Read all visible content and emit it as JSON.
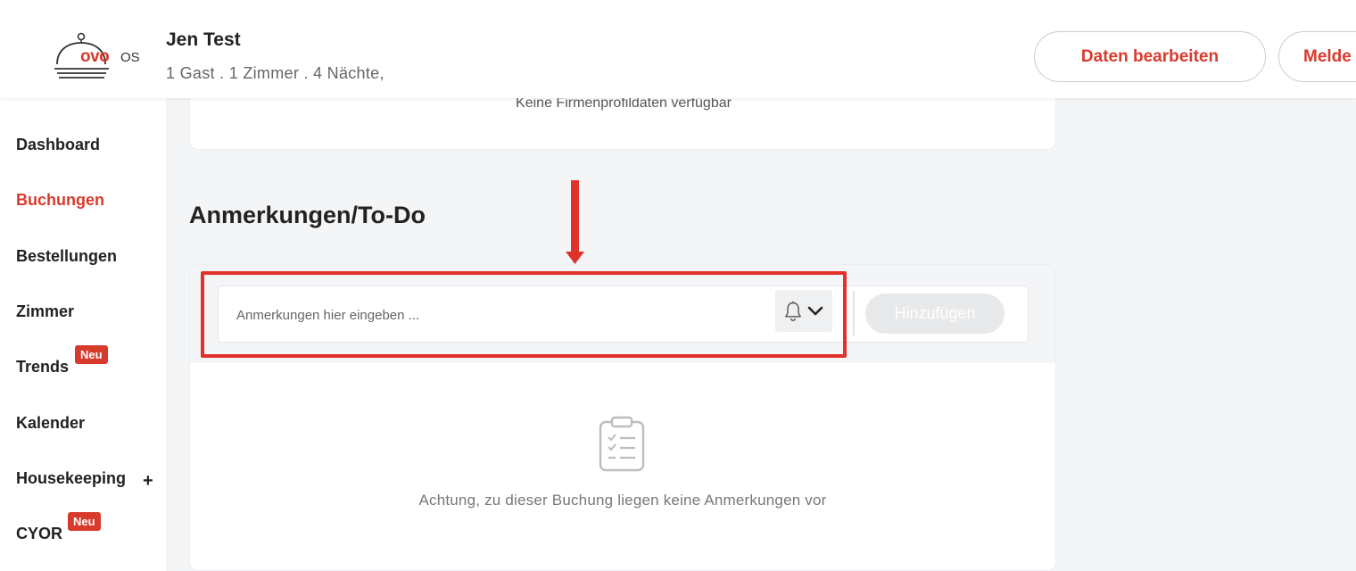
{
  "header": {
    "logo_wordmark": "ovo",
    "logo_suffix": "OS",
    "guest_name": "Jen Test",
    "guest_info": "1 Gast . 1 Zimmer . 4 Nächte,",
    "edit_button": "Daten bearbeiten",
    "report_button": "Melde"
  },
  "sidebar": {
    "items": [
      {
        "label": "Dashboard"
      },
      {
        "label": "Buchungen"
      },
      {
        "label": "Bestellungen"
      },
      {
        "label": "Zimmer"
      },
      {
        "label": "Trends",
        "badge": "Neu"
      },
      {
        "label": "Kalender"
      },
      {
        "label": "Housekeeping",
        "expand": "+"
      },
      {
        "label": "CYOR",
        "badge": "Neu"
      }
    ],
    "active": "Buchungen"
  },
  "company_profile": {
    "empty_text": "Keine Firmenprofildaten verfügbar"
  },
  "notes": {
    "title": "Anmerkungen/To-Do",
    "input_placeholder": "Anmerkungen hier eingeben ...",
    "input_value": "",
    "add_button": "Hinzufügen",
    "empty_text": "Achtung, zu dieser Buchung liegen keine Anmerkungen vor"
  },
  "icons": {
    "logo": "cloche-icon",
    "reminder": "bell-icon",
    "dropdown": "chevron-down-icon",
    "empty_state": "clipboard-list-icon",
    "annotation": "arrow-down-icon"
  },
  "colors": {
    "accent": "#d83a2c",
    "annotation": "#e0312a",
    "background": "#f4f5f7"
  }
}
